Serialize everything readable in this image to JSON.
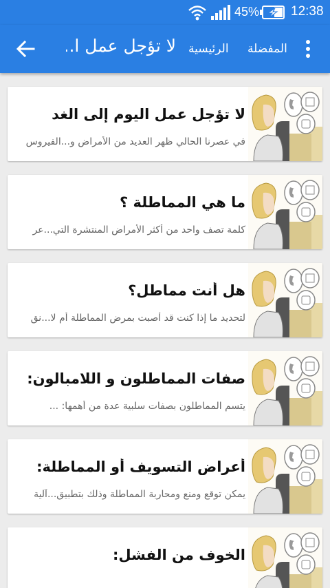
{
  "status_bar": {
    "battery_percent": "45%",
    "time": "12:38"
  },
  "toolbar": {
    "title": "لا تؤجل عمل ا...",
    "home_label": "الرئيسية",
    "favorites_label": "المفضلة"
  },
  "colors": {
    "primary": "#2a7fe3",
    "background": "#ececec",
    "card": "#ffffff",
    "description_text": "#666666"
  },
  "items": [
    {
      "title": "لا تؤجل عمل اليوم إلى الغد",
      "description": "في عصرنا الحالي ظهر العديد من الأمراض و...الفيروس"
    },
    {
      "title": "ما هي المماطلة ؟",
      "description": "كلمة تصف واحد من أكثر الأمراض المنتشرة التي...عر"
    },
    {
      "title": "هل أنت مماطل؟",
      "description": "لتحديد ما إذا كنت قد أصبت بمرض المماطلة أم لا...نق"
    },
    {
      "title": "صفات المماطلون و اللامبالون:",
      "description": "يتسم المماطلون بصفات سلبية عدة من أهمها: ..."
    },
    {
      "title": "أعراض التسويف أو المماطلة:",
      "description": "يمكن توقع ومنع ومحاربة المماطلة وذلك بتطبيق...آلية"
    },
    {
      "title": "الخوف من الفشل:",
      "description": ""
    }
  ]
}
